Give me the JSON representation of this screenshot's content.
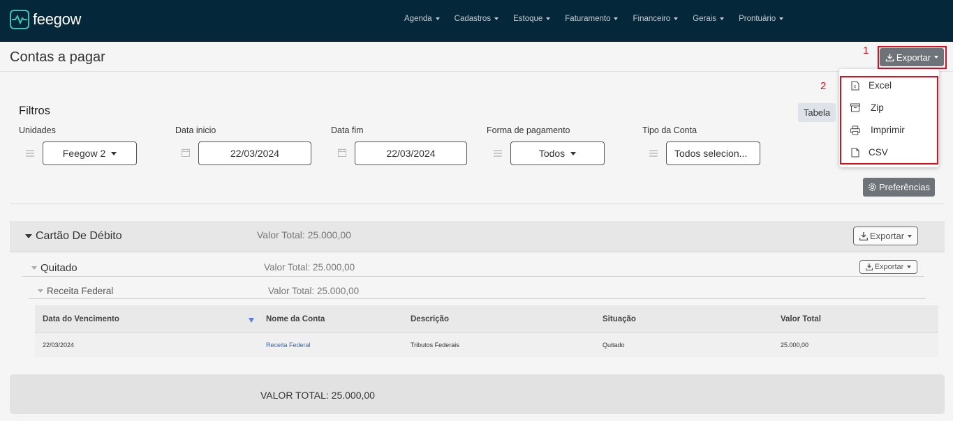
{
  "app": {
    "name": "feegow"
  },
  "nav": {
    "items": [
      {
        "label": "Agenda"
      },
      {
        "label": "Cadastros"
      },
      {
        "label": "Estoque"
      },
      {
        "label": "Faturamento"
      },
      {
        "label": "Financeiro"
      },
      {
        "label": "Gerais"
      },
      {
        "label": "Prontuário"
      }
    ]
  },
  "page": {
    "title": "Contas a pagar",
    "export_label": "Exportar"
  },
  "annotations": {
    "step1": "1",
    "step2": "2"
  },
  "export_menu": {
    "items": [
      {
        "label": "Excel",
        "icon": "excel-file-icon"
      },
      {
        "label": "Zip",
        "icon": "archive-icon"
      },
      {
        "label": "Imprimir",
        "icon": "printer-icon"
      },
      {
        "label": "CSV",
        "icon": "file-icon"
      }
    ]
  },
  "filters": {
    "title": "Filtros",
    "view_button": "Tabela",
    "unidades": {
      "label": "Unidades",
      "value": "Feegow 2"
    },
    "data_inicio": {
      "label": "Data inicio",
      "value": "22/03/2024"
    },
    "data_fim": {
      "label": "Data fim",
      "value": "22/03/2024"
    },
    "forma_pagamento": {
      "label": "Forma de pagamento",
      "value": "Todos"
    },
    "tipo_conta": {
      "label": "Tipo da Conta",
      "value": "Todos selecion..."
    },
    "preferences_button": "Preferências"
  },
  "groups": {
    "level1": {
      "title": "Cartão De Débito",
      "total": "Valor Total: 25.000,00",
      "export_label": "Exportar"
    },
    "level2": {
      "title": "Quitado",
      "total": "Valor Total: 25.000,00",
      "export_label": "Exportar"
    },
    "level3": {
      "title": "Receita Federal",
      "total": "Valor Total: 25.000,00"
    }
  },
  "table": {
    "columns": [
      "Data do Vencimento",
      "Nome da Conta",
      "Descrição",
      "Situação",
      "Valor Total"
    ],
    "rows": [
      [
        "22/03/2024",
        "Receita Federal",
        "Tributos Federais",
        "Quitado",
        "25.000,00"
      ]
    ]
  },
  "footer": {
    "total": "VALOR TOTAL: 25.000,00"
  },
  "colors": {
    "topbar": "#04273a",
    "brand": "#3fc3b5",
    "annotation": "#e10b1c",
    "button_gray": "#6d7378",
    "link": "#2a6ad3"
  }
}
